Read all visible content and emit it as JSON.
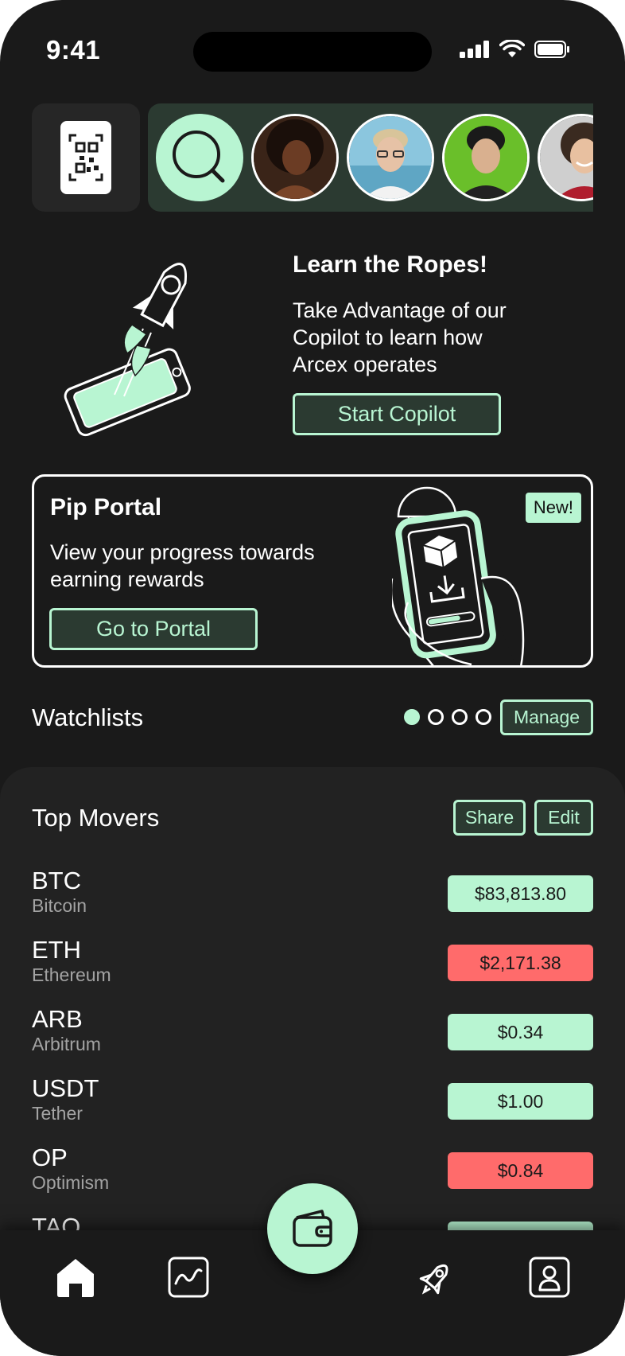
{
  "status_bar": {
    "time": "9:41"
  },
  "stories": {
    "items": [
      "story-1",
      "story-2",
      "story-3",
      "story-4"
    ]
  },
  "learn": {
    "title": "Learn the Ropes!",
    "body": "Take Advantage of our Copilot to learn how Arcex operates",
    "button_label": "Start Copilot"
  },
  "portal": {
    "title": "Pip Portal",
    "body": "View your progress towards earning rewards",
    "button_label": "Go to Portal",
    "badge": "New!"
  },
  "watchlists": {
    "title": "Watchlists",
    "page_count": 4,
    "active_page": 1,
    "manage_label": "Manage"
  },
  "movers": {
    "title": "Top Movers",
    "share_label": "Share",
    "edit_label": "Edit",
    "assets": [
      {
        "ticker": "BTC",
        "name": "Bitcoin",
        "price": "$83,813.80",
        "status": "up"
      },
      {
        "ticker": "ETH",
        "name": "Ethereum",
        "price": "$2,171.38",
        "status": "down"
      },
      {
        "ticker": "ARB",
        "name": "Arbitrum",
        "price": "$0.34",
        "status": "up"
      },
      {
        "ticker": "USDT",
        "name": "Tether",
        "price": "$1.00",
        "status": "up"
      },
      {
        "ticker": "OP",
        "name": "Optimism",
        "price": "$0.84",
        "status": "down"
      },
      {
        "ticker": "TAO",
        "name": "",
        "price": "",
        "status": "up"
      }
    ]
  },
  "tabbar": {
    "tabs": [
      "home-icon",
      "chart-icon",
      "wallet-icon",
      "rocket-icon",
      "profile-icon"
    ],
    "active": "home-icon"
  },
  "colors": {
    "background": "#1a1a1a",
    "panel": "#222222",
    "accent": "#b8f5d2",
    "accent_dark": "#2b3a31",
    "negative": "#ff6b6b"
  }
}
